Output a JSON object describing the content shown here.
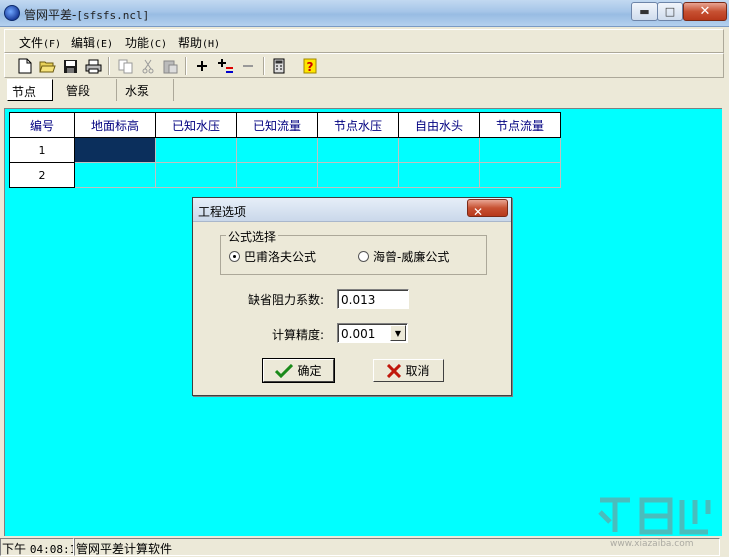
{
  "window": {
    "title": "管网平差-",
    "file": "[sfsfs.ncl]"
  },
  "menu": [
    {
      "label": "文件",
      "key": "(F)"
    },
    {
      "label": "编辑",
      "key": "(E)"
    },
    {
      "label": "功能",
      "key": "(C)"
    },
    {
      "label": "帮助",
      "key": "(H)"
    }
  ],
  "toolbar": {
    "icons": [
      "new-file-icon",
      "open-folder-icon",
      "save-icon",
      "print-icon",
      "copy-icon",
      "cut-icon",
      "paste-icon",
      "add-node-icon",
      "add-pipe-icon",
      "remove-icon",
      "calculator-icon",
      "help-icon"
    ]
  },
  "tabs": [
    "节点",
    "管段",
    "水泵"
  ],
  "grid": {
    "headers": [
      "编号",
      "地面标高",
      "已知水压",
      "已知流量",
      "节点水压",
      "自由水头",
      "节点流量"
    ],
    "rows": [
      "1",
      "2"
    ]
  },
  "dialog": {
    "title": "工程选项",
    "group_label": "公式选择",
    "option1": "巴甫洛夫公式",
    "option2": "海曾-威廉公式",
    "resistance_label": "缺省阻力系数:",
    "resistance_value": "0.013",
    "precision_label": "计算精度:",
    "precision_value": "0.001",
    "ok_label": "确定",
    "cancel_label": "取消"
  },
  "status": {
    "time_prefix": "下午",
    "time": "04:08:1",
    "app_name": "管网平差计算软件"
  },
  "watermark": {
    "site": "www.xiazaiba.com"
  },
  "colors": {
    "workspace": "#00ffff",
    "header_text": "#000080",
    "selected_cell": "#0b2f5c",
    "close_red": "#c75132"
  }
}
